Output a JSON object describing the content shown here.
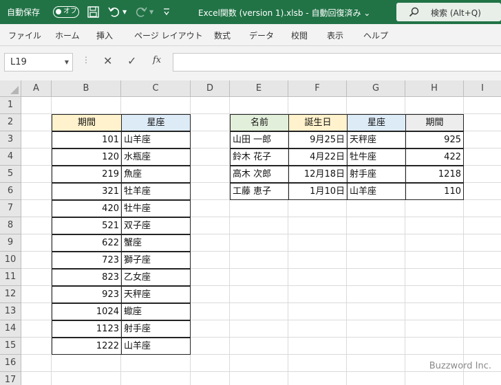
{
  "title_bar": {
    "autosave_label": "自動保存",
    "autosave_state": "オフ",
    "filename": "Excel関数 (version 1).xlsb - 自動回復済み ⌄",
    "search_label": "検索 (Alt+Q)"
  },
  "ribbon_tabs": [
    "ファイル",
    "ホーム",
    "挿入",
    "ページ レイアウト",
    "数式",
    "データ",
    "校閲",
    "表示",
    "ヘルプ"
  ],
  "formula_bar": {
    "name_box": "L19",
    "formula": ""
  },
  "columns": [
    "A",
    "B",
    "C",
    "D",
    "E",
    "F",
    "G",
    "H",
    "I"
  ],
  "rows": [
    "1",
    "2",
    "3",
    "4",
    "5",
    "6",
    "7",
    "8",
    "9",
    "10",
    "11",
    "12",
    "13",
    "14",
    "15",
    "16",
    "17"
  ],
  "table_left": {
    "headers": [
      "期間",
      "星座"
    ],
    "header_colors": [
      "#fff2cc",
      "#ddebf7"
    ],
    "rows": [
      [
        "101",
        "山羊座"
      ],
      [
        "120",
        "水瓶座"
      ],
      [
        "219",
        "魚座"
      ],
      [
        "321",
        "牡羊座"
      ],
      [
        "420",
        "牡牛座"
      ],
      [
        "521",
        "双子座"
      ],
      [
        "622",
        "蟹座"
      ],
      [
        "723",
        "獅子座"
      ],
      [
        "823",
        "乙女座"
      ],
      [
        "923",
        "天秤座"
      ],
      [
        "1024",
        "蠍座"
      ],
      [
        "1123",
        "射手座"
      ],
      [
        "1222",
        "山羊座"
      ]
    ]
  },
  "table_right": {
    "headers": [
      "名前",
      "誕生日",
      "星座",
      "期間"
    ],
    "header_colors": [
      "#e2efda",
      "#fff2cc",
      "#ddebf7",
      "#ededed"
    ],
    "rows": [
      [
        "山田 一郎",
        "9月25日",
        "天秤座",
        "925"
      ],
      [
        "鈴木 花子",
        "4月22日",
        "牡牛座",
        "422"
      ],
      [
        "高木 次郎",
        "12月18日",
        "射手座",
        "1218"
      ],
      [
        "工藤 恵子",
        "1月10日",
        "山羊座",
        "110"
      ]
    ]
  },
  "watermark": "Buzzword Inc."
}
